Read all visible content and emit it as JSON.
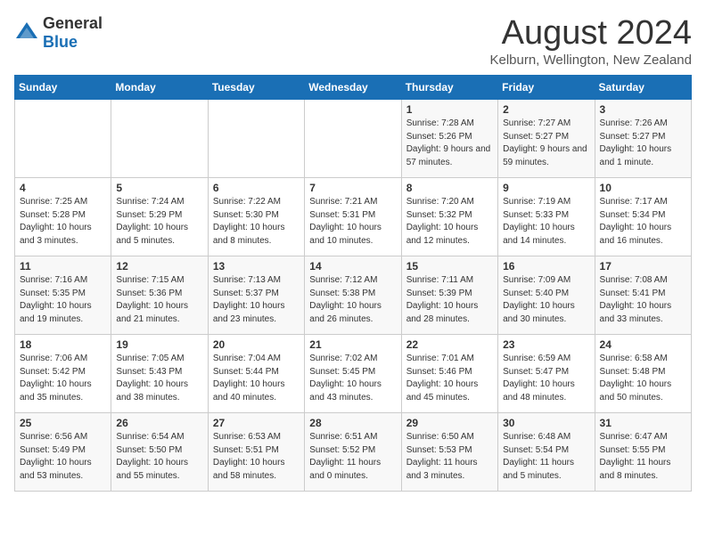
{
  "header": {
    "logo_general": "General",
    "logo_blue": "Blue",
    "month_year": "August 2024",
    "location": "Kelburn, Wellington, New Zealand"
  },
  "weekdays": [
    "Sunday",
    "Monday",
    "Tuesday",
    "Wednesday",
    "Thursday",
    "Friday",
    "Saturday"
  ],
  "weeks": [
    [
      {
        "day": "",
        "sunrise": "",
        "sunset": "",
        "daylight": ""
      },
      {
        "day": "",
        "sunrise": "",
        "sunset": "",
        "daylight": ""
      },
      {
        "day": "",
        "sunrise": "",
        "sunset": "",
        "daylight": ""
      },
      {
        "day": "",
        "sunrise": "",
        "sunset": "",
        "daylight": ""
      },
      {
        "day": "1",
        "sunrise": "Sunrise: 7:28 AM",
        "sunset": "Sunset: 5:26 PM",
        "daylight": "Daylight: 9 hours and 57 minutes."
      },
      {
        "day": "2",
        "sunrise": "Sunrise: 7:27 AM",
        "sunset": "Sunset: 5:27 PM",
        "daylight": "Daylight: 9 hours and 59 minutes."
      },
      {
        "day": "3",
        "sunrise": "Sunrise: 7:26 AM",
        "sunset": "Sunset: 5:27 PM",
        "daylight": "Daylight: 10 hours and 1 minute."
      }
    ],
    [
      {
        "day": "4",
        "sunrise": "Sunrise: 7:25 AM",
        "sunset": "Sunset: 5:28 PM",
        "daylight": "Daylight: 10 hours and 3 minutes."
      },
      {
        "day": "5",
        "sunrise": "Sunrise: 7:24 AM",
        "sunset": "Sunset: 5:29 PM",
        "daylight": "Daylight: 10 hours and 5 minutes."
      },
      {
        "day": "6",
        "sunrise": "Sunrise: 7:22 AM",
        "sunset": "Sunset: 5:30 PM",
        "daylight": "Daylight: 10 hours and 8 minutes."
      },
      {
        "day": "7",
        "sunrise": "Sunrise: 7:21 AM",
        "sunset": "Sunset: 5:31 PM",
        "daylight": "Daylight: 10 hours and 10 minutes."
      },
      {
        "day": "8",
        "sunrise": "Sunrise: 7:20 AM",
        "sunset": "Sunset: 5:32 PM",
        "daylight": "Daylight: 10 hours and 12 minutes."
      },
      {
        "day": "9",
        "sunrise": "Sunrise: 7:19 AM",
        "sunset": "Sunset: 5:33 PM",
        "daylight": "Daylight: 10 hours and 14 minutes."
      },
      {
        "day": "10",
        "sunrise": "Sunrise: 7:17 AM",
        "sunset": "Sunset: 5:34 PM",
        "daylight": "Daylight: 10 hours and 16 minutes."
      }
    ],
    [
      {
        "day": "11",
        "sunrise": "Sunrise: 7:16 AM",
        "sunset": "Sunset: 5:35 PM",
        "daylight": "Daylight: 10 hours and 19 minutes."
      },
      {
        "day": "12",
        "sunrise": "Sunrise: 7:15 AM",
        "sunset": "Sunset: 5:36 PM",
        "daylight": "Daylight: 10 hours and 21 minutes."
      },
      {
        "day": "13",
        "sunrise": "Sunrise: 7:13 AM",
        "sunset": "Sunset: 5:37 PM",
        "daylight": "Daylight: 10 hours and 23 minutes."
      },
      {
        "day": "14",
        "sunrise": "Sunrise: 7:12 AM",
        "sunset": "Sunset: 5:38 PM",
        "daylight": "Daylight: 10 hours and 26 minutes."
      },
      {
        "day": "15",
        "sunrise": "Sunrise: 7:11 AM",
        "sunset": "Sunset: 5:39 PM",
        "daylight": "Daylight: 10 hours and 28 minutes."
      },
      {
        "day": "16",
        "sunrise": "Sunrise: 7:09 AM",
        "sunset": "Sunset: 5:40 PM",
        "daylight": "Daylight: 10 hours and 30 minutes."
      },
      {
        "day": "17",
        "sunrise": "Sunrise: 7:08 AM",
        "sunset": "Sunset: 5:41 PM",
        "daylight": "Daylight: 10 hours and 33 minutes."
      }
    ],
    [
      {
        "day": "18",
        "sunrise": "Sunrise: 7:06 AM",
        "sunset": "Sunset: 5:42 PM",
        "daylight": "Daylight: 10 hours and 35 minutes."
      },
      {
        "day": "19",
        "sunrise": "Sunrise: 7:05 AM",
        "sunset": "Sunset: 5:43 PM",
        "daylight": "Daylight: 10 hours and 38 minutes."
      },
      {
        "day": "20",
        "sunrise": "Sunrise: 7:04 AM",
        "sunset": "Sunset: 5:44 PM",
        "daylight": "Daylight: 10 hours and 40 minutes."
      },
      {
        "day": "21",
        "sunrise": "Sunrise: 7:02 AM",
        "sunset": "Sunset: 5:45 PM",
        "daylight": "Daylight: 10 hours and 43 minutes."
      },
      {
        "day": "22",
        "sunrise": "Sunrise: 7:01 AM",
        "sunset": "Sunset: 5:46 PM",
        "daylight": "Daylight: 10 hours and 45 minutes."
      },
      {
        "day": "23",
        "sunrise": "Sunrise: 6:59 AM",
        "sunset": "Sunset: 5:47 PM",
        "daylight": "Daylight: 10 hours and 48 minutes."
      },
      {
        "day": "24",
        "sunrise": "Sunrise: 6:58 AM",
        "sunset": "Sunset: 5:48 PM",
        "daylight": "Daylight: 10 hours and 50 minutes."
      }
    ],
    [
      {
        "day": "25",
        "sunrise": "Sunrise: 6:56 AM",
        "sunset": "Sunset: 5:49 PM",
        "daylight": "Daylight: 10 hours and 53 minutes."
      },
      {
        "day": "26",
        "sunrise": "Sunrise: 6:54 AM",
        "sunset": "Sunset: 5:50 PM",
        "daylight": "Daylight: 10 hours and 55 minutes."
      },
      {
        "day": "27",
        "sunrise": "Sunrise: 6:53 AM",
        "sunset": "Sunset: 5:51 PM",
        "daylight": "Daylight: 10 hours and 58 minutes."
      },
      {
        "day": "28",
        "sunrise": "Sunrise: 6:51 AM",
        "sunset": "Sunset: 5:52 PM",
        "daylight": "Daylight: 11 hours and 0 minutes."
      },
      {
        "day": "29",
        "sunrise": "Sunrise: 6:50 AM",
        "sunset": "Sunset: 5:53 PM",
        "daylight": "Daylight: 11 hours and 3 minutes."
      },
      {
        "day": "30",
        "sunrise": "Sunrise: 6:48 AM",
        "sunset": "Sunset: 5:54 PM",
        "daylight": "Daylight: 11 hours and 5 minutes."
      },
      {
        "day": "31",
        "sunrise": "Sunrise: 6:47 AM",
        "sunset": "Sunset: 5:55 PM",
        "daylight": "Daylight: 11 hours and 8 minutes."
      }
    ]
  ]
}
